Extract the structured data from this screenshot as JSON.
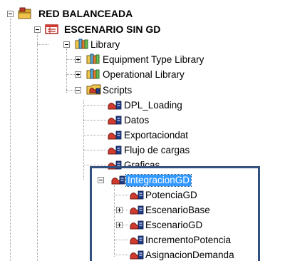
{
  "tree": {
    "root": {
      "label": "RED BALANCEADA"
    },
    "scenario": {
      "label": "ESCENARIO SIN GD"
    },
    "library": {
      "label": "Library"
    },
    "equipment_type_library": {
      "label": "Equipment Type Library"
    },
    "operational_library": {
      "label": "Operational Library"
    },
    "scripts": {
      "label": "Scripts"
    },
    "script_items": [
      {
        "label": "DPL_Loading"
      },
      {
        "label": "Datos"
      },
      {
        "label": "Exportaciondat"
      },
      {
        "label": "Flujo de cargas"
      },
      {
        "label": "Graficas"
      }
    ],
    "integracion": {
      "label": "IntegracionGD"
    },
    "integracion_children": [
      {
        "label": "PotenciaGD"
      },
      {
        "label": "EscenarioBase"
      },
      {
        "label": "EscenarioGD"
      },
      {
        "label": "IncrementoPotencia"
      },
      {
        "label": "AsignacionDemanda"
      }
    ]
  },
  "colors": {
    "selection": "#3399ff",
    "highlight_border": "#34507e"
  }
}
